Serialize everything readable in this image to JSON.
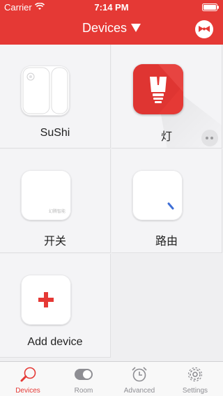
{
  "status_bar": {
    "carrier": "Carrier",
    "time": "7:14 PM"
  },
  "nav": {
    "title": "Devices",
    "dropdown_icon": "triangle-down-icon",
    "right_icon": "bowtie-bell-icon"
  },
  "colors": {
    "brand": "#e53935",
    "background": "#efeff1",
    "tab_inactive": "#8e8e93"
  },
  "devices": [
    {
      "label": "SuShi",
      "icon": "door-sensor-icon"
    },
    {
      "label": "灯",
      "icon": "light-bulb-icon"
    },
    {
      "label": "开关",
      "icon": "switch-icon",
      "brand": "幻腾智能"
    },
    {
      "label": "路由",
      "icon": "router-icon"
    },
    {
      "label": "Add device",
      "icon": "plus-icon"
    }
  ],
  "tabs": [
    {
      "label": "Devices",
      "icon": "bulb-tab-icon",
      "active": true
    },
    {
      "label": "Room",
      "icon": "toggle-icon",
      "active": false
    },
    {
      "label": "Advanced",
      "icon": "alarm-clock-icon",
      "active": false
    },
    {
      "label": "Settings",
      "icon": "gear-icon",
      "active": false
    }
  ]
}
